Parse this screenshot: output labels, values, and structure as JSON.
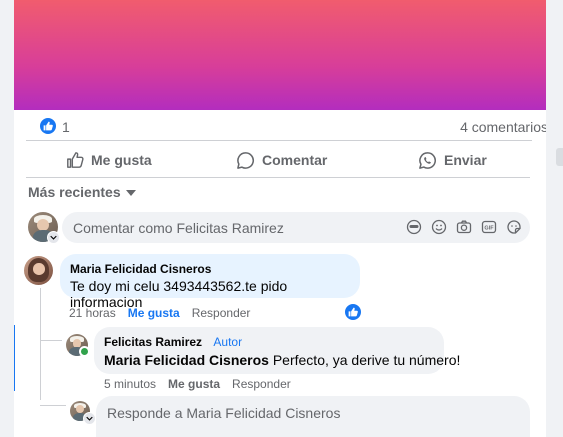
{
  "post": {
    "reactions_count": "1",
    "comments_count": "4 comentarios"
  },
  "actions": {
    "like_label": "Me gusta",
    "comment_label": "Comentar",
    "share_label": "Enviar"
  },
  "sort": {
    "label": "Más recientes"
  },
  "composer": {
    "placeholder": "Comentar como Felicitas Ramirez"
  },
  "comments": [
    {
      "author": "Maria Felicidad Cisneros",
      "text": "Te doy mi celu 3493443562.te pido informacion",
      "time": "21 horas",
      "like_label": "Me gusta",
      "reply_label": "Responder"
    }
  ],
  "reply": {
    "author": "Felicitas Ramirez",
    "author_badge": "Autor",
    "mention": "Maria Felicidad Cisneros",
    "text": "Perfecto, ya derive tu número!",
    "time": "5 minutos",
    "like_label": "Me gusta",
    "reply_label": "Responder"
  },
  "reply_input": {
    "placeholder": "Responde a Maria Felicidad Cisneros"
  },
  "colors": {
    "accent": "#1877f2",
    "bubble": "#f0f2f5",
    "muted": "#65676b"
  }
}
